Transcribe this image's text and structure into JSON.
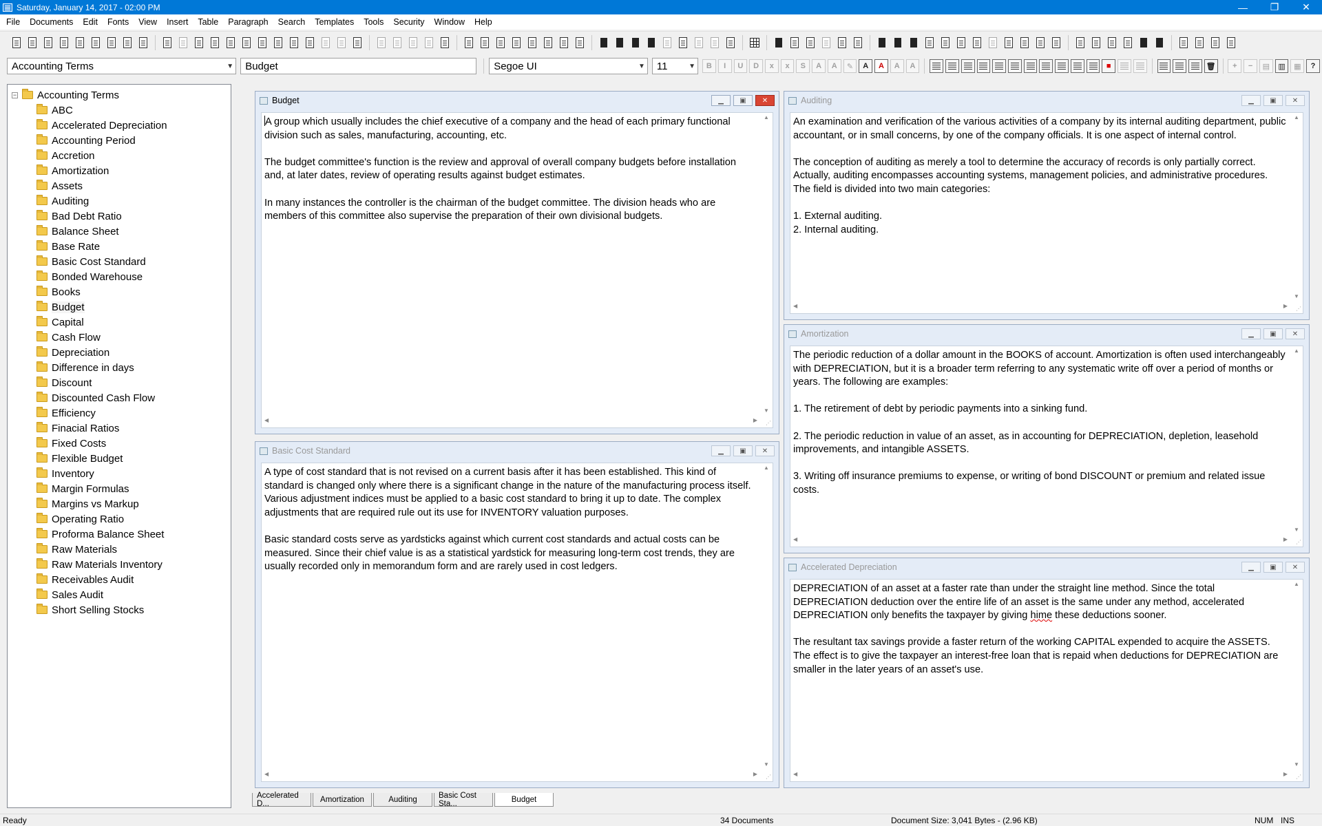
{
  "window": {
    "title": "Saturday, January 14, 2017 - 02:00 PM",
    "controls": {
      "minimize": "—",
      "maximize": "❐",
      "close": "✕"
    }
  },
  "menu": [
    "File",
    "Documents",
    "Edit",
    "Fonts",
    "View",
    "Insert",
    "Table",
    "Paragraph",
    "Search",
    "Templates",
    "Tools",
    "Security",
    "Window",
    "Help"
  ],
  "formatbar": {
    "category": "Accounting Terms",
    "document": "Budget",
    "font": "Segoe UI",
    "size": "11"
  },
  "tree": {
    "root": "Accounting Terms",
    "selected": "Budget",
    "items": [
      "ABC",
      "Accelerated Depreciation",
      "Accounting Period",
      "Accretion",
      "Amortization",
      "Assets",
      "Auditing",
      "Bad Debt Ratio",
      "Balance Sheet",
      "Base Rate",
      "Basic Cost Standard",
      "Bonded Warehouse",
      "Books",
      "Budget",
      "Capital",
      "Cash Flow",
      "Depreciation",
      "Difference in days",
      "Discount",
      "Discounted Cash Flow",
      "Efficiency",
      "Finacial Ratios",
      "Fixed Costs",
      "Flexible Budget",
      "Inventory",
      "Margin Formulas",
      "Margins vs Markup",
      "Operating Ratio",
      "Proforma Balance Sheet",
      "Raw Materials",
      "Raw Materials Inventory",
      "Receivables Audit",
      "Sales Audit",
      "Short Selling Stocks"
    ]
  },
  "windows": {
    "budget": {
      "title": "Budget",
      "p1": "A group which usually includes the chief executive of a company and the head of each primary functional division such as sales, manufacturing, accounting, etc.",
      "p2": "The budget committee's function is the review and approval of overall company budgets before installation and, at later dates, review of operating results against budget estimates.",
      "p3": "In many instances the controller is the chairman of the budget committee. The division heads who are members of this committee also supervise the preparation of their own divisional budgets."
    },
    "basic_cost_standard": {
      "title": "Basic Cost Standard",
      "p1": "A type of cost standard that is not revised on a current basis after it has been established.  This kind of standard is changed only where there is a significant change in the nature of the manufacturing process itself.  Various adjustment indices must be applied to a basic cost standard to bring it up to date.  The complex adjustments that are required rule out its use for INVENTORY valuation purposes.",
      "p2": "Basic standard costs serve as yardsticks against which current cost standards and actual costs can be measured.  Since their chief value is as a statistical yardstick for measuring long-term cost trends, they are usually recorded only in memorandum form and are rarely used in cost ledgers."
    },
    "auditing": {
      "title": "Auditing",
      "p1": "An examination and verification of the various activities of a company by its internal auditing department, public accountant, or in small concerns, by one of the company officials.  It is one aspect of internal control.",
      "p2": "The conception of auditing as merely a tool to determine the accuracy of records is only partially correct.  Actually, auditing encompasses accounting systems, management policies, and administrative procedures.  The field is divided into two main categories:",
      "l1": "1.  External auditing.",
      "l2": "2.  Internal auditing."
    },
    "amortization": {
      "title": "Amortization",
      "p1": "The periodic reduction of a dollar amount in the BOOKS of account.  Amortization is often used interchangeably with DEPRECIATION, but it is a broader term referring to any systematic write off over a period of months or years. The following are examples:",
      "p2": "1.  The retirement of debt by periodic payments into a sinking fund.",
      "p3": "2.  The periodic reduction in value of an asset, as in accounting for DEPRECIATION, depletion, leasehold improvements, and intangible ASSETS.",
      "p4": "3.  Writing off insurance premiums to expense, or writing of bond DISCOUNT or premium and related issue costs."
    },
    "accelerated_depreciation": {
      "title": "Accelerated Depreciation",
      "p1_a": "DEPRECIATION of an asset at a faster rate than under the straight line method. Since the total DEPRECIATION deduction over the entire life of an asset is the same under any method, accelerated DEPRECIATION only benefits the taxpayer by giving ",
      "p1_typo": "hime",
      "p1_b": " these deductions sooner.",
      "p2": "The resultant tax savings provide a faster return of the working CAPITAL expended to acquire the ASSETS.  The effect is to give the taxpayer an interest-free loan that is repaid when deductions for DEPRECIATION are smaller in the later years of an asset's use."
    }
  },
  "tabs": [
    "Accelerated D...",
    "Amortization",
    "Auditing",
    "Basic Cost Sta...",
    "Budget"
  ],
  "active_tab": "Budget",
  "status": {
    "ready": "Ready",
    "documents": "34  Documents",
    "size": "Document Size:  3,041 Bytes - (2.96 KB)",
    "num": "NUM",
    "ins": "INS"
  }
}
